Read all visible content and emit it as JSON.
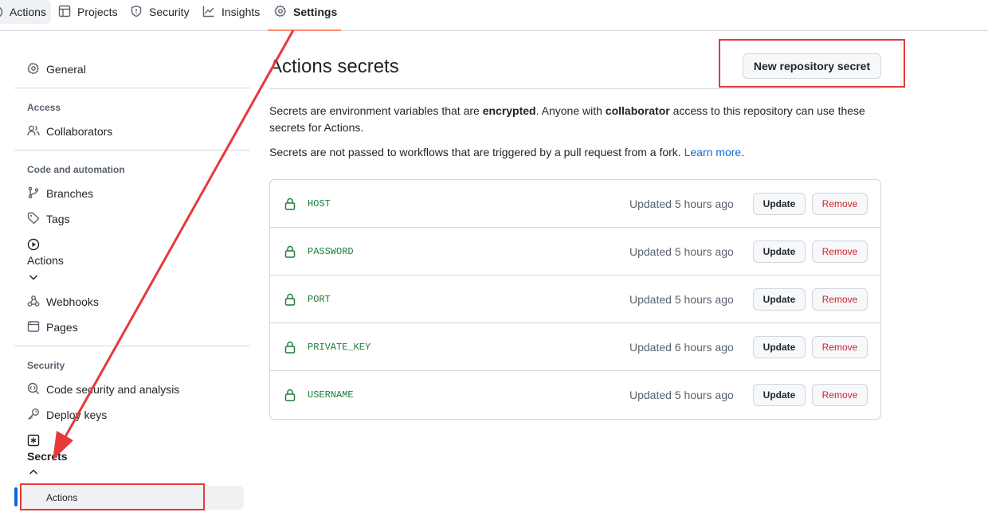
{
  "topnav": {
    "tabs": [
      {
        "label": "Actions",
        "icon": "play-icon"
      },
      {
        "label": "Projects",
        "icon": "table-icon"
      },
      {
        "label": "Security",
        "icon": "shield-icon"
      },
      {
        "label": "Insights",
        "icon": "graph-icon"
      },
      {
        "label": "Settings",
        "icon": "gear-icon"
      }
    ],
    "active_tab": "Settings"
  },
  "sidebar": {
    "general": "General",
    "access_heading": "Access",
    "collaborators": "Collaborators",
    "code_heading": "Code and automation",
    "branches": "Branches",
    "tags": "Tags",
    "actions": "Actions",
    "webhooks": "Webhooks",
    "pages": "Pages",
    "security_heading": "Security",
    "code_security": "Code security and analysis",
    "deploy_keys": "Deploy keys",
    "secrets": "Secrets",
    "secrets_actions": "Actions"
  },
  "main": {
    "title": "Actions secrets",
    "new_secret_button": "New repository secret",
    "desc1_a": "Secrets are environment variables that are ",
    "desc1_b": "encrypted",
    "desc1_c": ". Anyone with ",
    "desc1_d": "collaborator",
    "desc1_e": " access to this repository can use these secrets for Actions.",
    "desc2_a": "Secrets are not passed to workflows that are triggered by a pull request from a fork. ",
    "desc2_link": "Learn more",
    "desc2_end": ".",
    "update_label": "Update",
    "remove_label": "Remove",
    "secrets": [
      {
        "name": "HOST",
        "updated": "Updated 5 hours ago"
      },
      {
        "name": "PASSWORD",
        "updated": "Updated 5 hours ago"
      },
      {
        "name": "PORT",
        "updated": "Updated 5 hours ago"
      },
      {
        "name": "PRIVATE_KEY",
        "updated": "Updated 6 hours ago"
      },
      {
        "name": "USERNAME",
        "updated": "Updated 5 hours ago"
      }
    ]
  },
  "colors": {
    "accent": "#0969da",
    "secret_name": "#1a7f37",
    "danger": "#cf222e",
    "annotation": "#e5393b",
    "tab_underline": "#fd8c73"
  }
}
